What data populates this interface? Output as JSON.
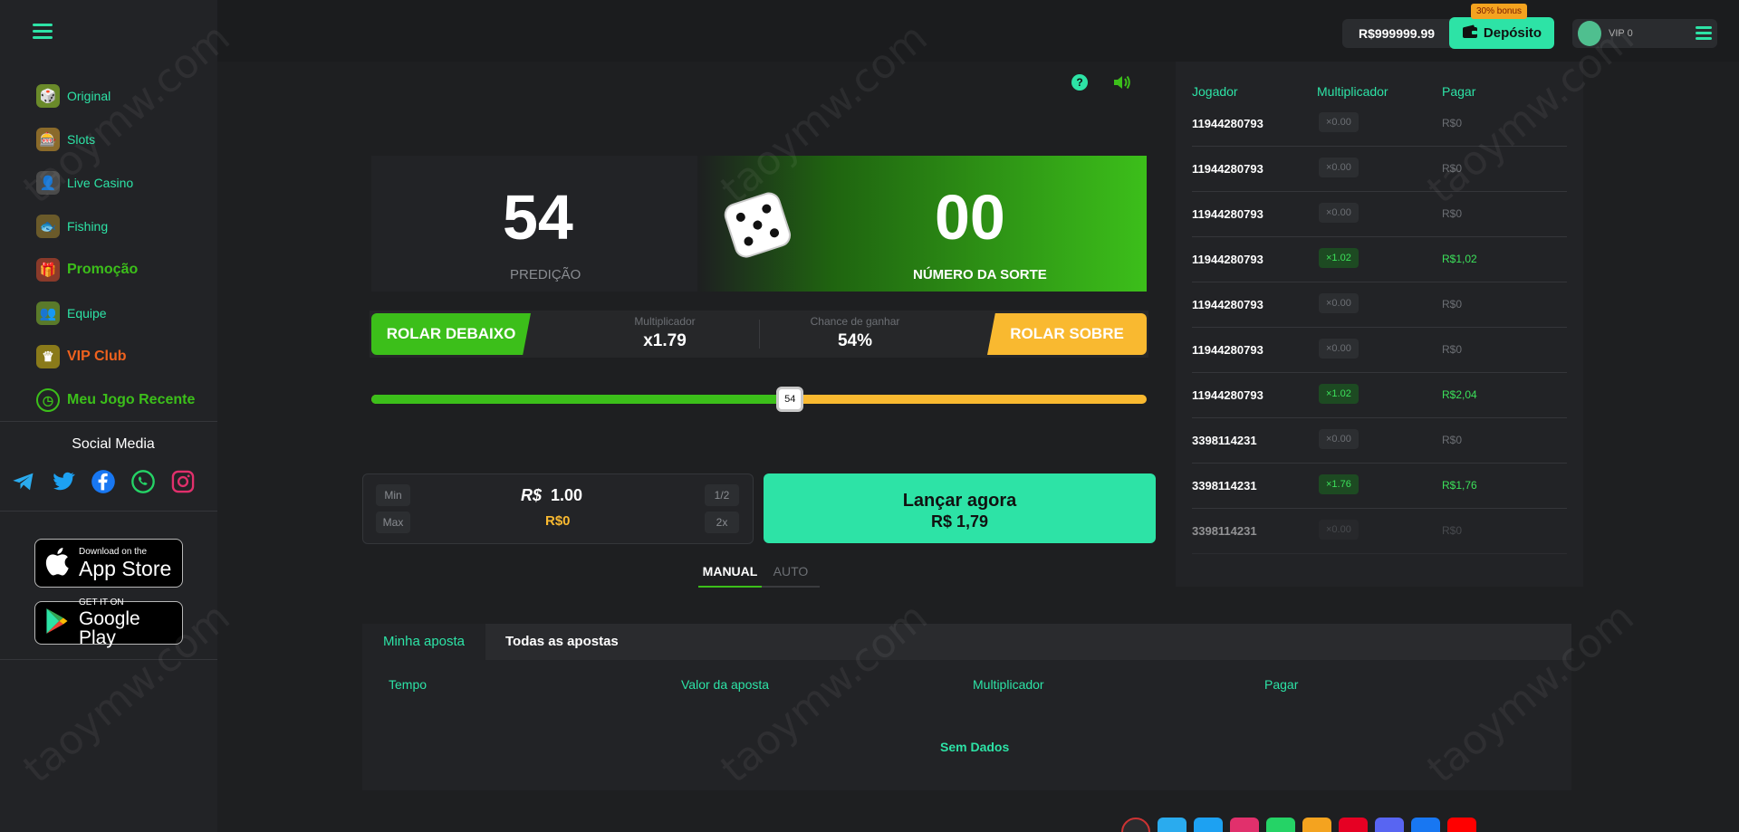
{
  "sidebar": {
    "items": [
      {
        "label": "Original",
        "color": "#2de3a6"
      },
      {
        "label": "Slots",
        "color": "#2de3a6"
      },
      {
        "label": "Live Casino",
        "color": "#2de3a6"
      },
      {
        "label": "Fishing",
        "color": "#2de3a6"
      },
      {
        "label": "Promoção",
        "color": "#3cbf1a"
      },
      {
        "label": "Equipe",
        "color": "#2de3a6"
      },
      {
        "label": "VIP Club",
        "color": "#f0621e"
      },
      {
        "label": "Meu Jogo Recente",
        "color": "#3cbf1a"
      }
    ],
    "social_title": "Social Media",
    "social_icons": [
      "telegram-icon",
      "twitter-icon",
      "facebook-icon",
      "whatsapp-icon",
      "instagram-icon"
    ],
    "app_store": {
      "small": "Download on the",
      "big": "App Store"
    },
    "google_play": {
      "small": "GET IT ON",
      "big": "Google Play"
    }
  },
  "header": {
    "balance": "R$999999.99",
    "deposit_label": "Depósito",
    "bonus_badge": "30% bonus",
    "vip_label": "VIP 0"
  },
  "game": {
    "prediction_value": "54",
    "prediction_label": "PREDIÇÃO",
    "lucky_value": "00",
    "lucky_label": "NÚMERO DA SORTE",
    "roll_under_label": "ROLAR DEBAIXO",
    "roll_over_label": "ROLAR SOBRE",
    "multiplier_label": "Multiplicador",
    "multiplier_value": "x1.79",
    "chance_label": "Chance de ganhar",
    "chance_value": "54%",
    "slider_value": "54",
    "slider_fraction": 0.54,
    "bet": {
      "min_label": "Min",
      "max_label": "Max",
      "half_label": "1/2",
      "double_label": "2x",
      "currency": "R$",
      "amount": "1.00",
      "win": "R$0"
    },
    "launch_line1": "Lançar agora",
    "launch_line2": "R$ 1,79",
    "mode_manual": "MANUAL",
    "mode_auto": "AUTO"
  },
  "players": {
    "headers": [
      "Jogador",
      "Multiplicador",
      "Pagar"
    ],
    "rows": [
      {
        "id": "11944280793",
        "mult": "×0.00",
        "pay": "R$0",
        "win": false
      },
      {
        "id": "11944280793",
        "mult": "×0.00",
        "pay": "R$0",
        "win": false
      },
      {
        "id": "11944280793",
        "mult": "×0.00",
        "pay": "R$0",
        "win": false
      },
      {
        "id": "11944280793",
        "mult": "×1.02",
        "pay": "R$1,02",
        "win": true
      },
      {
        "id": "11944280793",
        "mult": "×0.00",
        "pay": "R$0",
        "win": false
      },
      {
        "id": "11944280793",
        "mult": "×0.00",
        "pay": "R$0",
        "win": false
      },
      {
        "id": "11944280793",
        "mult": "×1.02",
        "pay": "R$2,04",
        "win": true
      },
      {
        "id": "3398114231",
        "mult": "×0.00",
        "pay": "R$0",
        "win": false
      },
      {
        "id": "3398114231",
        "mult": "×1.76",
        "pay": "R$1,76",
        "win": true
      },
      {
        "id": "3398114231",
        "mult": "×0.00",
        "pay": "R$0",
        "win": false
      }
    ]
  },
  "history": {
    "tab_mine": "Minha aposta",
    "tab_all": "Todas as apostas",
    "columns": [
      "Tempo",
      "Valor da aposta",
      "Multiplicador",
      "Pagar"
    ],
    "empty": "Sem Dados"
  },
  "watermark_text": "taoymw.com",
  "colors": {
    "accent": "#2de3a6",
    "green": "#3cbf1a",
    "yellow": "#f9b930",
    "orange": "#f0621e"
  }
}
